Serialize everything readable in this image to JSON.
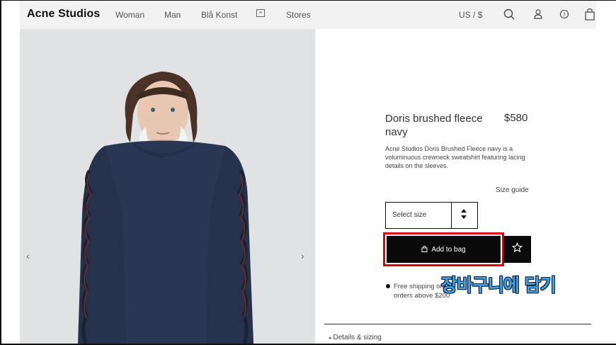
{
  "header": {
    "logo": "Acne Studios",
    "nav": [
      "Woman",
      "Man",
      "Blå Konst",
      "Stores"
    ],
    "currency": "US / $"
  },
  "product": {
    "title": "Doris brushed fleece navy",
    "price": "$580",
    "description": "Acne Studios Doris Brushed Fleece navy is a voluminuous crewneck sweatshirt featuring lacing details on the sleeves.",
    "size_guide": "Size guide",
    "select_size": "Select size",
    "add_to_bag": "Add to bag",
    "shipping": "Free shipping on orders above $200",
    "details": "Details & sizing"
  },
  "gallery": {
    "prev": "‹",
    "next": "›"
  },
  "annotation": "장바구니에 담기",
  "colors": {
    "header_bg": "#f2f2f2",
    "button_bg": "#0a0a0a",
    "highlight": "#e00000",
    "annotation": "#3fa0e6"
  }
}
